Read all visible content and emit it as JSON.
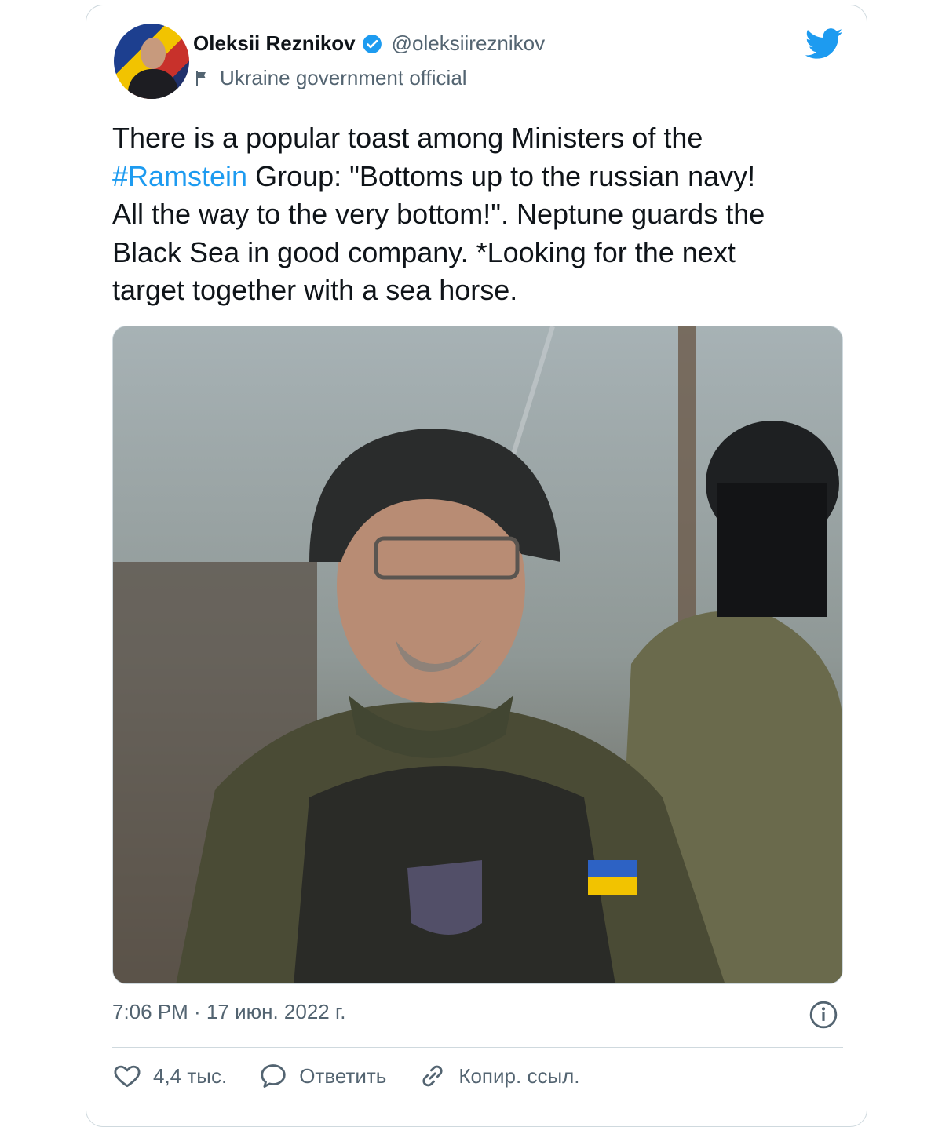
{
  "tweet": {
    "author_name": "Oleksii Reznikov",
    "handle": "@oleksiireznikov",
    "account_label": "Ukraine government official",
    "text_lines": [
      "There is a popular toast among Ministers of the",
      "#Ramstein",
      " Group: \"Bottoms up to the russian navy!",
      "All the way to the very bottom!\". Neptune guards the",
      "Black Sea in good company. *Looking for the next",
      "target together with a sea horse."
    ],
    "timestamp": "7:06 PM · 17 июн. 2022 г.",
    "actions": {
      "like_count": "4,4 тыс.",
      "reply_label": "Ответить",
      "copy_link_label": "Копир. ссыл."
    }
  },
  "icons": {
    "verified": "verified-badge-icon",
    "flag": "flag-icon",
    "brand": "twitter-bird-icon",
    "info": "info-icon",
    "like": "heart-icon",
    "reply": "speech-bubble-icon",
    "link": "link-icon"
  },
  "colors": {
    "accent": "#1d9bf0",
    "text": "#0f1419",
    "muted": "#536471",
    "border": "#cfd9de"
  }
}
